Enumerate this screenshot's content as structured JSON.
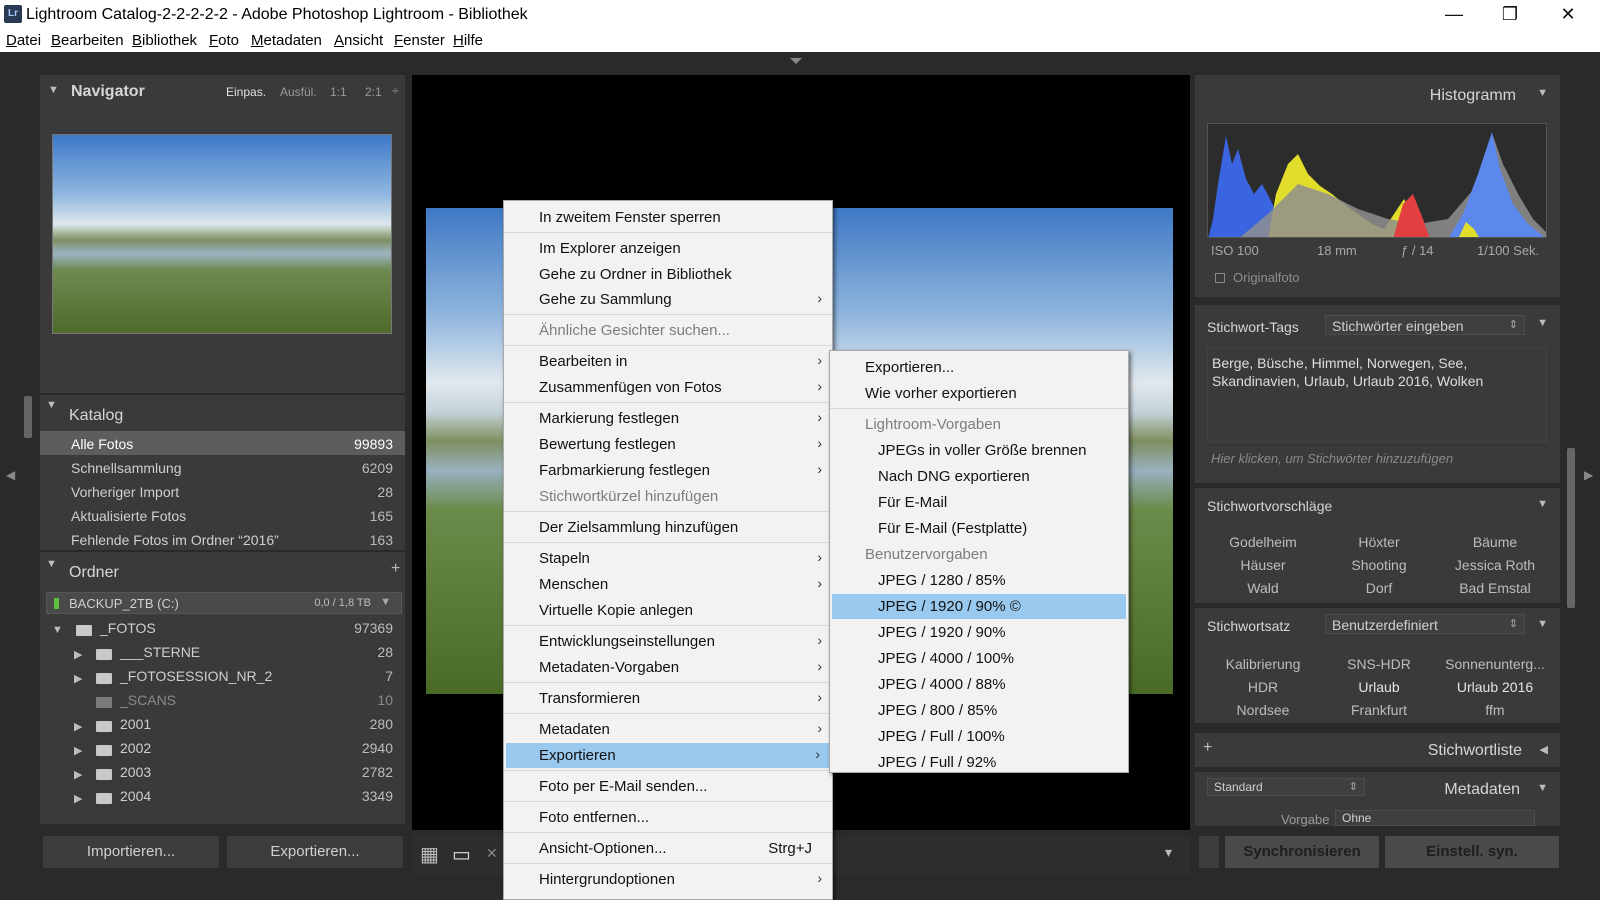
{
  "window": {
    "icon": "Lr",
    "title": "Lightroom Catalog-2-2-2-2-2 - Adobe Photoshop Lightroom - Bibliothek",
    "minimize": "—",
    "restore": "❐",
    "close": "✕"
  },
  "menubar": [
    "Datei",
    "Bearbeiten",
    "Bibliothek",
    "Foto",
    "Metadaten",
    "Ansicht",
    "Fenster",
    "Hilfe"
  ],
  "navigator": {
    "title": "Navigator",
    "zoom": [
      "Einpas.",
      "Ausfül.",
      "1:1",
      "2:1"
    ],
    "zoom_more": "÷"
  },
  "catalog": {
    "title": "Katalog",
    "items": [
      {
        "label": "Alle Fotos",
        "count": "99893"
      },
      {
        "label": "Schnellsammlung",
        "count": "6209"
      },
      {
        "label": "Vorheriger Import",
        "count": "28"
      },
      {
        "label": "Aktualisierte Fotos",
        "count": "165"
      },
      {
        "label": "Fehlende Fotos im Ordner “2016”",
        "count": "163"
      }
    ]
  },
  "folders": {
    "title": "Ordner",
    "add": "+",
    "volume": {
      "name": "BACKUP_2TB (C:)",
      "size": "0,0 / 1,8 TB"
    },
    "items": [
      {
        "label": "_FOTOS",
        "count": "97369"
      },
      {
        "label": "___STERNE",
        "count": "28"
      },
      {
        "label": "_FOTOSESSION_NR_2",
        "count": "7"
      },
      {
        "label": "_SCANS",
        "count": "10"
      },
      {
        "label": "2001",
        "count": "280"
      },
      {
        "label": "2002",
        "count": "2940"
      },
      {
        "label": "2003",
        "count": "2782"
      },
      {
        "label": "2004",
        "count": "3349"
      }
    ]
  },
  "buttons": {
    "import": "Importieren...",
    "export": "Exportieren...",
    "sync": "Synchronisieren",
    "sync_settings": "Einstell. syn."
  },
  "context_menu": {
    "items": [
      {
        "label": "In zweitem Fenster sperren"
      },
      {
        "label": "Im Explorer anzeigen"
      },
      {
        "label": "Gehe zu Ordner in Bibliothek"
      },
      {
        "label": "Gehe zu Sammlung",
        "arrow": "›"
      },
      {
        "label": "Ähnliche Gesichter suchen..."
      },
      {
        "label": "Bearbeiten in",
        "arrow": "›"
      },
      {
        "label": "Zusammenfügen von Fotos",
        "arrow": "›"
      },
      {
        "label": "Markierung festlegen",
        "arrow": "›"
      },
      {
        "label": "Bewertung festlegen",
        "arrow": "›"
      },
      {
        "label": "Farbmarkierung festlegen",
        "arrow": "›"
      },
      {
        "label": "Stichwortkürzel hinzufügen"
      },
      {
        "label": "Der Zielsammlung hinzufügen"
      },
      {
        "label": "Stapeln",
        "arrow": "›"
      },
      {
        "label": "Menschen",
        "arrow": "›"
      },
      {
        "label": "Virtuelle Kopie anlegen"
      },
      {
        "label": "Entwicklungseinstellungen",
        "arrow": "›"
      },
      {
        "label": "Metadaten-Vorgaben",
        "arrow": "›"
      },
      {
        "label": "Transformieren",
        "arrow": "›"
      },
      {
        "label": "Metadaten",
        "arrow": "›"
      },
      {
        "label": "Exportieren",
        "arrow": "›"
      },
      {
        "label": "Foto per E-Mail senden..."
      },
      {
        "label": "Foto entfernen..."
      },
      {
        "label": "Ansicht-Optionen...",
        "shortcut": "Strg+J"
      },
      {
        "label": "Hintergrundoptionen",
        "arrow": "›"
      }
    ]
  },
  "export_submenu": {
    "items": [
      {
        "label": "Exportieren..."
      },
      {
        "label": "Wie vorher exportieren"
      },
      {
        "label": "Lightroom-Vorgaben"
      },
      {
        "label": "JPEGs in voller Größe brennen"
      },
      {
        "label": "Nach DNG exportieren"
      },
      {
        "label": "Für E-Mail"
      },
      {
        "label": "Für E-Mail (Festplatte)"
      },
      {
        "label": "Benutzervorgaben"
      },
      {
        "label": "JPEG / 1280 / 85%"
      },
      {
        "label": "JPEG / 1920 / 90%  ©"
      },
      {
        "label": "JPEG / 1920 / 90%"
      },
      {
        "label": "JPEG / 4000 / 100%"
      },
      {
        "label": "JPEG / 4000 / 88%"
      },
      {
        "label": "JPEG / 800 / 85%"
      },
      {
        "label": "JPEG / Full / 100%"
      },
      {
        "label": "JPEG / Full / 92%"
      }
    ]
  },
  "histogram": {
    "title": "Histogramm",
    "iso": "ISO 100",
    "focal": "18 mm",
    "aperture": "ƒ / 14",
    "shutter": "1/100 Sek.",
    "original": "Originalfoto"
  },
  "keyword_tags": {
    "title": "Stichwort-Tags",
    "dropdown": "Stichwörter eingeben",
    "keywords": "Berge, Büsche, Himmel, Norwegen, See, Skandinavien, Urlaub, Urlaub 2016, Wolken",
    "placeholder": "Hier klicken, um Stichwörter hinzuzufügen"
  },
  "suggestions": {
    "title": "Stichwortvorschläge",
    "items": [
      "Godelheim",
      "Höxter",
      "Bäume",
      "Häuser",
      "Shooting",
      "Jessica Roth",
      "Wald",
      "Dorf",
      "Bad Emstal"
    ]
  },
  "keyword_set": {
    "title": "Stichwortsatz",
    "dropdown": "Benutzerdefiniert",
    "items": [
      "Kalibrierung",
      "SNS-HDR",
      "Sonnenunterg...",
      "HDR",
      "Urlaub",
      "Urlaub 2016",
      "Nordsee",
      "Frankfurt",
      "ffm"
    ]
  },
  "keyword_list": {
    "title": "Stichwortliste",
    "add": "+"
  },
  "metadata": {
    "title": "Metadaten",
    "preset_dropdown": "Standard",
    "preset_label": "Vorgabe",
    "preset_value": "Ohne"
  },
  "toolbar": {
    "grid": "▦",
    "loupe": "▭",
    "compare": "✕",
    "menu_arrow": "▾"
  },
  "colors": {
    "menu_highlight": "#99c9ef",
    "panel_bg": "#3a3a3a",
    "app_bg": "#2a2a2a"
  }
}
